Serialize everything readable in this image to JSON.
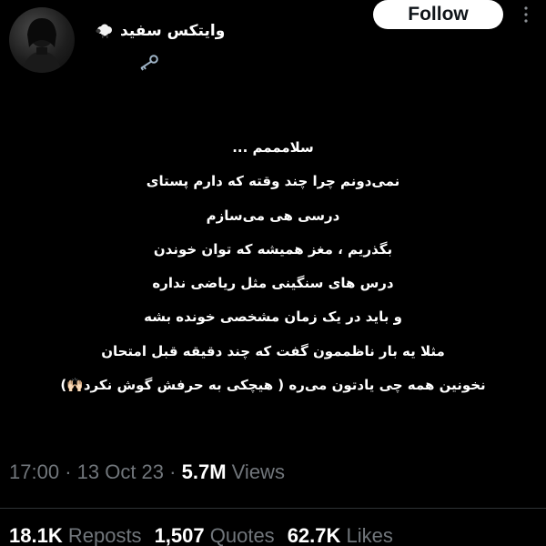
{
  "author": {
    "display_name": "وایتکس سفید",
    "name_emoji": "sheep-emoji",
    "extra_icon": "key-icon"
  },
  "header": {
    "follow_label": "Follow",
    "more_icon": "more-vertical-icon"
  },
  "tweet": {
    "lines": [
      "سلامممم ...",
      "نمی‌دونم چرا چند وقته که دارم پستای",
      "درسی هی می‌سازم",
      "بگذریم ، مغز همیشه که توان خوندن",
      "درس های سنگینی مثل ریاضی نداره",
      "و باید در یک زمان مشخصی خونده بشه",
      "مثلا یه بار ناظممون گفت که چند دقیقه قبل امتحان",
      "نخونین همه چی یادتون می‌ره ( هیچکی به حرفش گوش نکرد🙌🏻)"
    ]
  },
  "meta": {
    "time": "17:00",
    "separator": "·",
    "date": "13 Oct 23",
    "views_count": "5.7M",
    "views_label": "Views"
  },
  "stats": {
    "reposts_count": "18.1K",
    "reposts_label": "Reposts",
    "quotes_count": "1,507",
    "quotes_label": "Quotes",
    "likes_count": "62.7K",
    "likes_label": "Likes"
  },
  "colors": {
    "background": "#000000",
    "text_primary": "#ffffff",
    "text_secondary": "#71767b",
    "follow_bg": "#ffffff",
    "follow_text": "#0f1419"
  }
}
